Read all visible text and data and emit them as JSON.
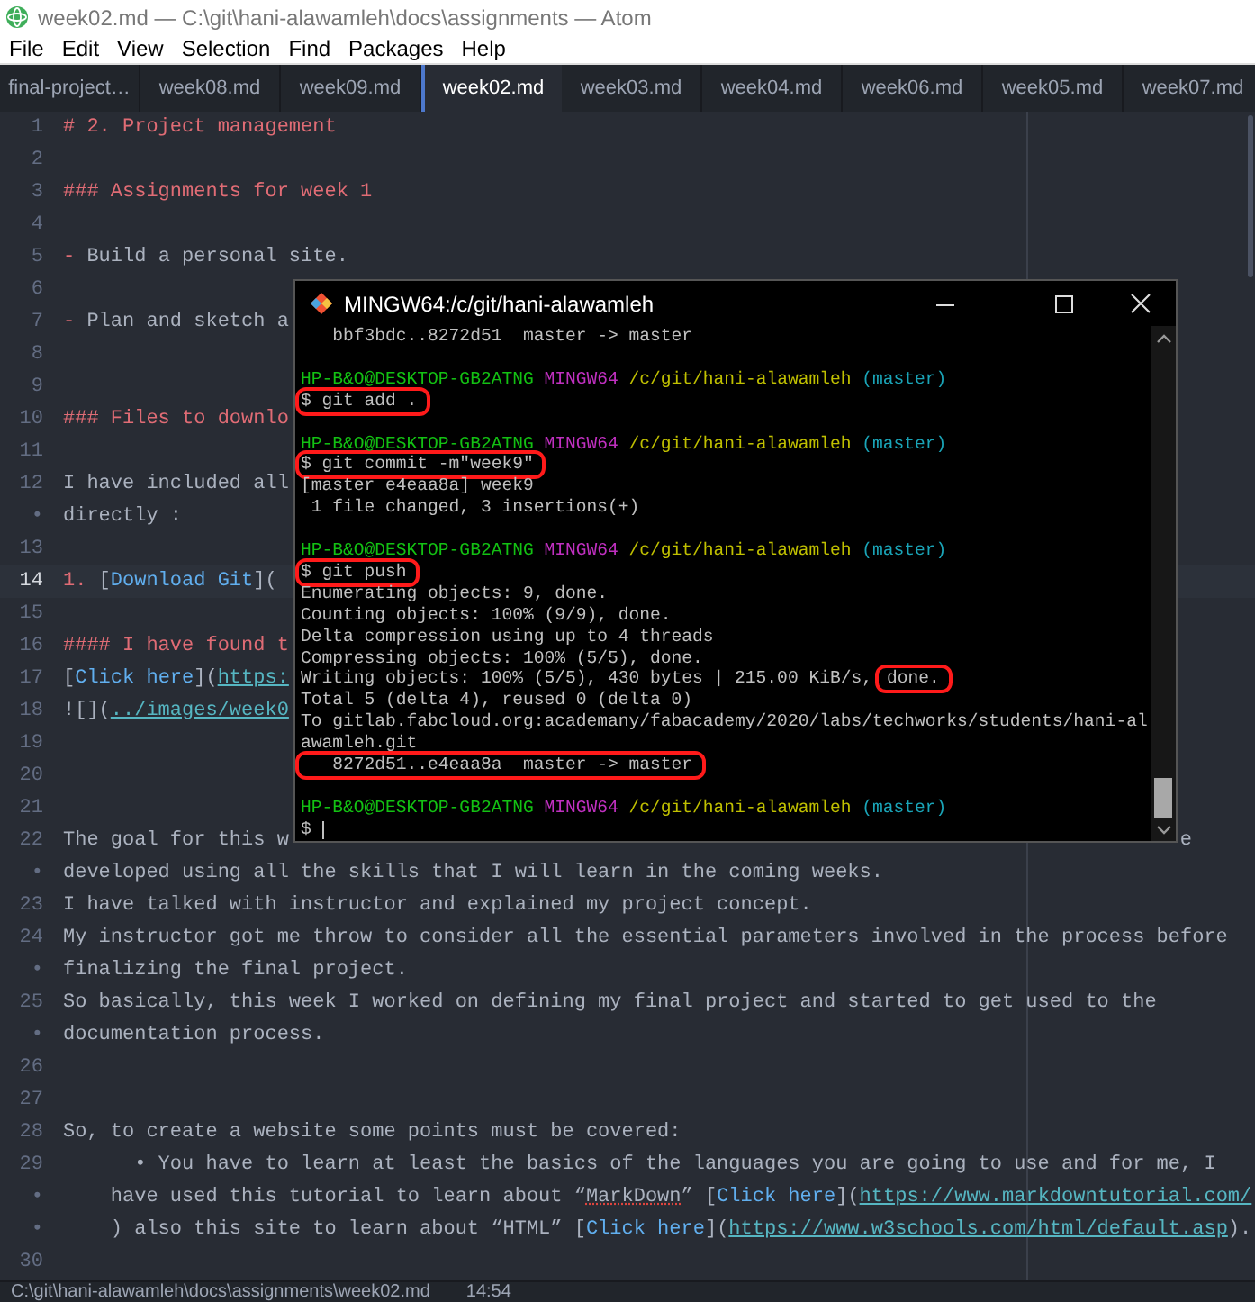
{
  "window": {
    "title": "week02.md — C:\\git\\hani-alawamleh\\docs\\assignments — Atom"
  },
  "menu": [
    "File",
    "Edit",
    "View",
    "Selection",
    "Find",
    "Packages",
    "Help"
  ],
  "tabs": [
    {
      "label": "final-project…",
      "selected": false
    },
    {
      "label": "week08.md",
      "selected": false
    },
    {
      "label": "week09.md",
      "selected": false
    },
    {
      "label": "week02.md",
      "selected": true
    },
    {
      "label": "week03.md",
      "selected": false
    },
    {
      "label": "week04.md",
      "selected": false
    },
    {
      "label": "week06.md",
      "selected": false
    },
    {
      "label": "week05.md",
      "selected": false
    },
    {
      "label": "week07.md",
      "selected": false
    }
  ],
  "editor": {
    "lines": [
      {
        "number": "1",
        "cursor": false,
        "rows": [
          {
            "segments": [
              {
                "kind": "heading",
                "text": "# 2. Project management"
              }
            ]
          }
        ]
      },
      {
        "number": "2",
        "cursor": false
      },
      {
        "number": "3",
        "cursor": false,
        "rows": [
          {
            "segments": [
              {
                "kind": "heading",
                "text": "### Assignments for week 1"
              }
            ]
          }
        ]
      },
      {
        "number": "4",
        "cursor": false
      },
      {
        "number": "5",
        "cursor": false,
        "rows": [
          {
            "segments": [
              {
                "kind": "heading",
                "text": "-"
              },
              {
                "kind": "plain",
                "text": " Build a personal site."
              }
            ]
          }
        ]
      },
      {
        "number": "6",
        "cursor": false
      },
      {
        "number": "7",
        "cursor": false,
        "rows": [
          {
            "segments": [
              {
                "kind": "heading",
                "text": "-"
              },
              {
                "kind": "plain",
                "text": " Plan and sketch a"
              }
            ]
          }
        ]
      },
      {
        "number": "8",
        "cursor": false
      },
      {
        "number": "9",
        "cursor": false
      },
      {
        "number": "10",
        "cursor": false,
        "rows": [
          {
            "segments": [
              {
                "kind": "heading",
                "text": "### Files to downlo"
              }
            ]
          }
        ]
      },
      {
        "number": "11",
        "cursor": false
      },
      {
        "number": "12",
        "cursor": false,
        "rows": [
          {
            "segments": [
              {
                "kind": "plain",
                "text": "I have included all"
              }
            ]
          },
          {
            "gutter": "•",
            "segments": [
              {
                "kind": "plain",
                "text": "directly :"
              }
            ]
          }
        ]
      },
      {
        "number": "13",
        "cursor": false
      },
      {
        "number": "14",
        "cursor": true,
        "rows": [
          {
            "segments": [
              {
                "kind": "heading",
                "text": "1."
              },
              {
                "kind": "plain",
                "text": " ["
              },
              {
                "kind": "link",
                "text": "Download Git"
              },
              {
                "kind": "plain",
                "text": "]("
              }
            ]
          }
        ]
      },
      {
        "number": "15",
        "cursor": false
      },
      {
        "number": "16",
        "cursor": false,
        "rows": [
          {
            "segments": [
              {
                "kind": "heading",
                "text": "#### I have found t"
              }
            ]
          }
        ]
      },
      {
        "number": "17",
        "cursor": false,
        "rows": [
          {
            "segments": [
              {
                "kind": "plain",
                "text": "["
              },
              {
                "kind": "link",
                "text": "Click here"
              },
              {
                "kind": "plain",
                "text": "]("
              },
              {
                "kind": "url",
                "text": "https:"
              }
            ]
          }
        ]
      },
      {
        "number": "18",
        "cursor": false,
        "rows": [
          {
            "segments": [
              {
                "kind": "plain",
                "text": "![]("
              },
              {
                "kind": "url",
                "text": "../images/week0"
              }
            ]
          }
        ]
      },
      {
        "number": "19",
        "cursor": false
      },
      {
        "number": "20",
        "cursor": false
      },
      {
        "number": "21",
        "cursor": false
      },
      {
        "number": "22",
        "cursor": false,
        "rows": [
          {
            "segments": [
              {
                "kind": "plain",
                "text": "The goal for this w"
              },
              {
                "kind": "far",
                "text": "e"
              }
            ]
          },
          {
            "gutter": "•",
            "segments": [
              {
                "kind": "plain",
                "text": "developed using all the skills that I will learn in the coming weeks."
              }
            ]
          }
        ]
      },
      {
        "number": "23",
        "cursor": false,
        "rows": [
          {
            "segments": [
              {
                "kind": "plain",
                "text": "I have talked with instructor and explained my project concept."
              }
            ]
          }
        ]
      },
      {
        "number": "24",
        "cursor": false,
        "rows": [
          {
            "segments": [
              {
                "kind": "plain",
                "text": "My instructor got me throw to consider all the essential parameters involved in the process before"
              }
            ]
          },
          {
            "gutter": "•",
            "segments": [
              {
                "kind": "plain",
                "text": "finalizing the final project."
              }
            ]
          }
        ]
      },
      {
        "number": "25",
        "cursor": false,
        "rows": [
          {
            "segments": [
              {
                "kind": "plain",
                "text": "So basically, this week I worked on defining my final project and started to get used to the"
              }
            ]
          },
          {
            "gutter": "•",
            "segments": [
              {
                "kind": "plain",
                "text": "documentation process."
              }
            ]
          }
        ]
      },
      {
        "number": "26",
        "cursor": false
      },
      {
        "number": "27",
        "cursor": false
      },
      {
        "number": "28",
        "cursor": false,
        "rows": [
          {
            "segments": [
              {
                "kind": "plain",
                "text": "So, to create a website some points must be covered:"
              }
            ]
          }
        ]
      },
      {
        "number": "29",
        "cursor": false,
        "rows": [
          {
            "segments": [
              {
                "kind": "plain",
                "text": "      • You have to learn at least the basics of the languages you are going to use and for me, I"
              }
            ]
          },
          {
            "gutter": "•",
            "segments": [
              {
                "kind": "plain",
                "text": "    have used this tutorial to learn about “"
              },
              {
                "kind": "misspelled",
                "text": "MarkDown"
              },
              {
                "kind": "plain",
                "text": "” ["
              },
              {
                "kind": "link",
                "text": "Click here"
              },
              {
                "kind": "plain",
                "text": "]("
              },
              {
                "kind": "url",
                "text": "https://www.markdowntutorial.com/"
              }
            ]
          },
          {
            "gutter": "•",
            "segments": [
              {
                "kind": "plain",
                "text": "    ) also this site to learn about “HTML” ["
              },
              {
                "kind": "link",
                "text": "Click here"
              },
              {
                "kind": "plain",
                "text": "]("
              },
              {
                "kind": "url",
                "text": "https://www.w3schools.com/html/default.asp"
              },
              {
                "kind": "plain",
                "text": ")."
              }
            ]
          }
        ]
      },
      {
        "number": "30",
        "cursor": false
      }
    ]
  },
  "terminal": {
    "title": "MINGW64:/c/git/hani-alawamleh",
    "lines": [
      {
        "kind": "output",
        "text": "   bbf3bdc..8272d51  master -> master",
        "circled": false
      },
      {
        "kind": "blank"
      },
      {
        "kind": "prompt",
        "user": "HP-B&O@DESKTOP-GB2ATNG",
        "shell": "MINGW64",
        "path": "/c/git/hani-alawamleh",
        "branch": "(master)"
      },
      {
        "kind": "output",
        "text": "$ git add .",
        "circled": true
      },
      {
        "kind": "blank"
      },
      {
        "kind": "prompt",
        "user": "HP-B&O@DESKTOP-GB2ATNG",
        "shell": "MINGW64",
        "path": "/c/git/hani-alawamleh",
        "branch": "(master)"
      },
      {
        "kind": "output",
        "text": "$ git commit -m\"week9\"",
        "circled": true
      },
      {
        "kind": "output",
        "text": "[master e4eaa8a] week9",
        "circled": false
      },
      {
        "kind": "output",
        "text": " 1 file changed, 3 insertions(+)",
        "circled": false
      },
      {
        "kind": "blank"
      },
      {
        "kind": "prompt",
        "user": "HP-B&O@DESKTOP-GB2ATNG",
        "shell": "MINGW64",
        "path": "/c/git/hani-alawamleh",
        "branch": "(master)"
      },
      {
        "kind": "output",
        "text": "$ git push",
        "circled": true
      },
      {
        "kind": "output",
        "text": "Enumerating objects: 9, done.",
        "circled": false
      },
      {
        "kind": "output",
        "text": "Counting objects: 100% (9/9), done.",
        "circled": false
      },
      {
        "kind": "output",
        "text": "Delta compression using up to 4 threads",
        "circled": false
      },
      {
        "kind": "output",
        "text": "Compressing objects: 100% (5/5), done.",
        "circled": false
      },
      {
        "kind": "output",
        "text": "Writing objects: 100% (5/5), 430 bytes | 215.00 KiB/s,",
        "circled": false,
        "tail": "done.",
        "tail_circled": true
      },
      {
        "kind": "output",
        "text": "Total 5 (delta 4), reused 0 (delta 0)",
        "circled": false
      },
      {
        "kind": "output",
        "text": "To gitlab.fabcloud.org:academany/fabacademy/2020/labs/techworks/students/hani-al",
        "circled": false
      },
      {
        "kind": "output",
        "text": "awamleh.git",
        "circled": false
      },
      {
        "kind": "output",
        "text": "   8272d51..e4eaa8a  master -> master",
        "circled": true
      },
      {
        "kind": "blank"
      },
      {
        "kind": "prompt",
        "user": "HP-B&O@DESKTOP-GB2ATNG",
        "shell": "MINGW64",
        "path": "/c/git/hani-alawamleh",
        "branch": "(master)"
      },
      {
        "kind": "cursor",
        "text": "$"
      }
    ]
  },
  "status_bar": {
    "path": "C:\\git\\hani-alawamleh\\docs\\assignments\\week02.md",
    "cursor_position": "14:54"
  }
}
